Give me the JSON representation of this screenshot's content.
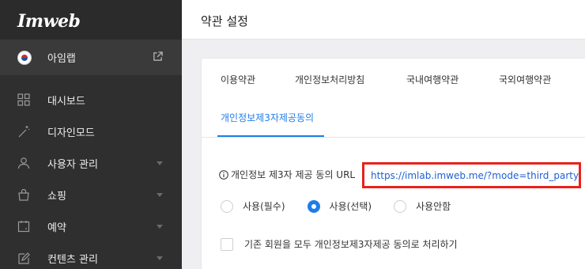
{
  "sidebar": {
    "logo": "Imweb",
    "site": {
      "name": "아임랩"
    },
    "items": [
      {
        "label": "대시보드",
        "icon": "dashboard-grid-icon",
        "has_caret": false
      },
      {
        "label": "디자인모드",
        "icon": "magic-wand-icon",
        "has_caret": false
      },
      {
        "label": "사용자 관리",
        "icon": "user-icon",
        "has_caret": true
      },
      {
        "label": "쇼핑",
        "icon": "shopping-bag-icon",
        "has_caret": true
      },
      {
        "label": "예약",
        "icon": "calendar-icon",
        "has_caret": true
      },
      {
        "label": "컨텐츠 관리",
        "icon": "edit-icon",
        "has_caret": true
      }
    ]
  },
  "header": {
    "title": "약관 설정"
  },
  "tabs": [
    {
      "label": "이용약관",
      "active": false
    },
    {
      "label": "개인정보처리방침",
      "active": false
    },
    {
      "label": "국내여행약관",
      "active": false
    },
    {
      "label": "국외여행약관",
      "active": false
    },
    {
      "label": "개인정보제3자제공동의",
      "active": true
    }
  ],
  "form": {
    "url_label": "개인정보 제3자 제공 동의 URL",
    "url_value": "https://imlab.imweb.me/?mode=third_party",
    "radio_options": [
      {
        "label": "사용(필수)",
        "checked": false
      },
      {
        "label": "사용(선택)",
        "checked": true
      },
      {
        "label": "사용안함",
        "checked": false
      }
    ],
    "checkbox_label": "기존 회원을 모두 개인정보제3자제공 동의로 처리하기",
    "checkbox_checked": false
  },
  "colors": {
    "accent": "#1e7ee8",
    "highlight_border": "#e8221c",
    "sidebar_bg": "#2f2f2f"
  }
}
